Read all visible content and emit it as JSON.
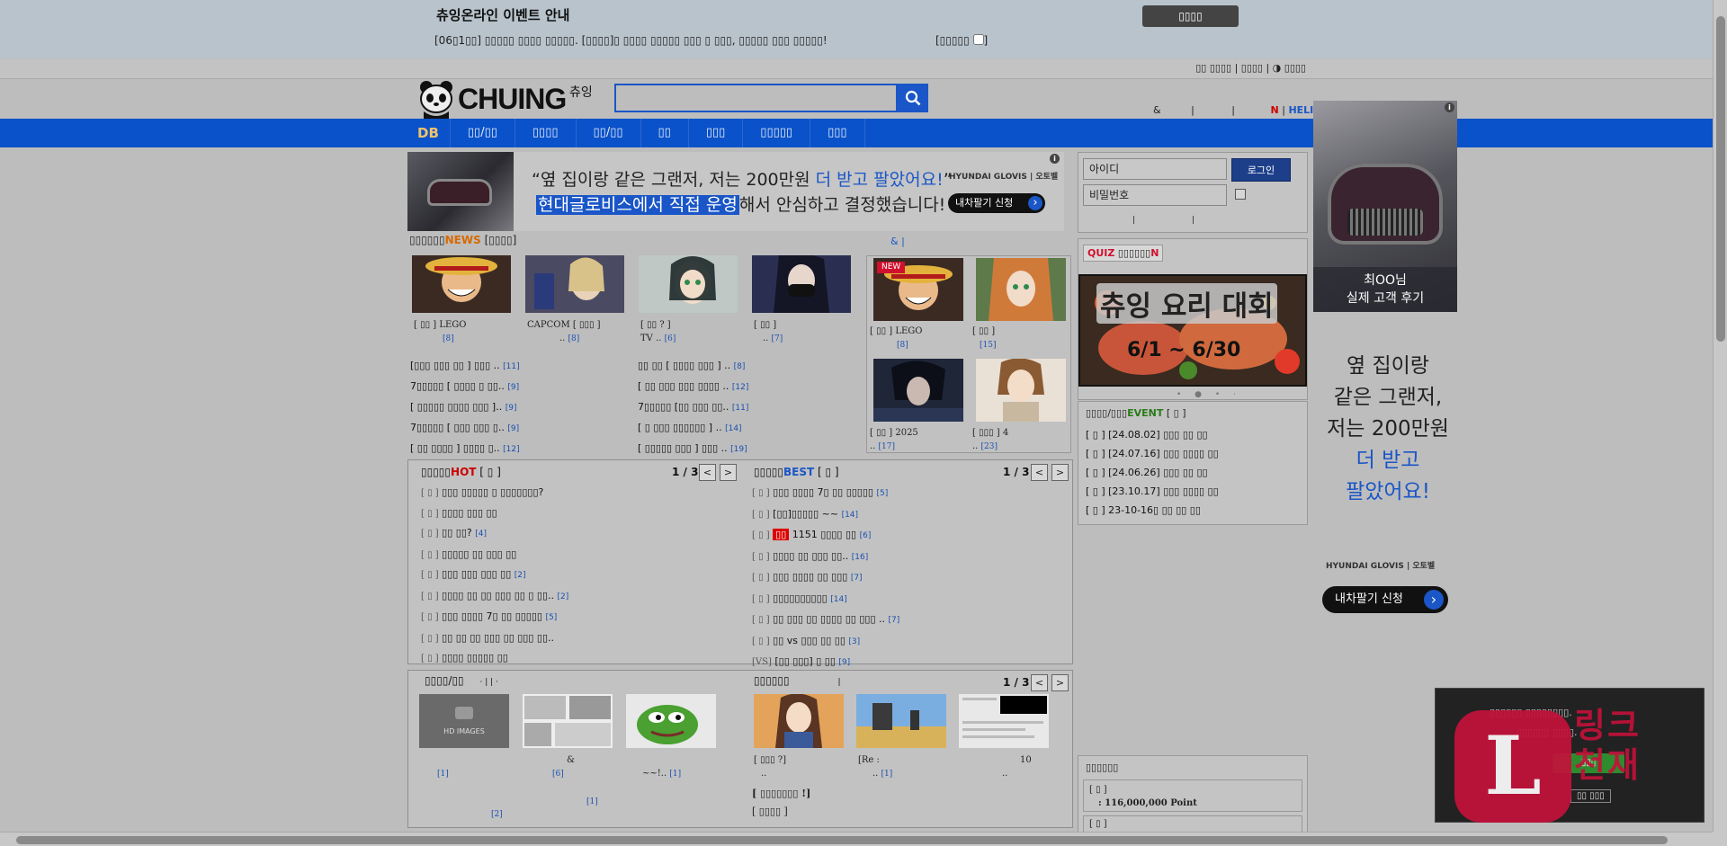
{
  "notice": {
    "title": "츄잉온라인 이벤트 안내",
    "close_label": "▯▯▯▯",
    "line": "[06▯1▯▯] ▯▯▯▯▯ ▯▯▯▯ ▯▯▯▯▯. [▯▯▯▯]▯ ▯▯▯▯ ▯▯▯▯▯ ▯▯▯ ▯ ▯▯▯, ▯▯▯▯▯ ▯▯▯ ▯▯▯▯▯!",
    "dont_show_label": "[▯▯▯▯▯",
    "dont_show_end": "]"
  },
  "toplinks": "▯▯ ▯▯▯▯ | ▯▯▯▯ | ◑ ▯▯▯▯",
  "header": {
    "logo_text": "CHUING",
    "logo_sub": "츄잉",
    "search_value": "",
    "right_amp": "&",
    "right_sep1": "|",
    "right_sep2": "|",
    "right_n": "N",
    "right_sep3": " | ",
    "right_helix": "HELIX"
  },
  "nav": {
    "items": [
      "DB",
      "▯▯/▯▯",
      "▯▯▯▯",
      "▯▯/▯▯",
      "▯▯",
      "▯▯▯",
      "▯▯▯▯▯",
      "▯▯▯"
    ]
  },
  "banner": {
    "line1_a": "“옆 집이랑 같은 그랜저, 저는 200만원 ",
    "line1_b": "더 받고 팔았어요!",
    "line1_c": "”",
    "line2_a": "현대글로비스에서 직접 운영",
    "line2_b": "해서 안심하고 결정했습니다!",
    "brand": "HYUNDAI GLOVIS | 오토벨",
    "cta": "내차팔기 신청",
    "info": "i"
  },
  "news": {
    "head_a": "▯▯▯▯▯▯",
    "head_tag": "NEWS",
    "head_b": " [▯▯▯▯]",
    "side_head": "&  |",
    "thumbs": [
      {
        "cap1": "[ ▯▯ ]  LEGO",
        "cnt": "[8]"
      },
      {
        "cap1": "CAPCOM [ ▯▯▯ ]",
        "cap2": "..",
        "cnt": "[8]"
      },
      {
        "cap1": "[ ▯▯ ? ]",
        "cap2": "TV ..",
        "cnt": "[6]"
      },
      {
        "cap1": "[ ▯▯ ]",
        "cap2": "..",
        "cnt": "[7]"
      }
    ],
    "list_left": [
      {
        "t": "[▯▯▯ ▯▯▯ ▯▯ ] ▯▯▯ ..",
        "c": "[11]"
      },
      {
        "t": "7▯▯▯▯▯ [ ▯▯▯▯ ▯ ▯▯..",
        "c": "[9]"
      },
      {
        "t": "[ ▯▯▯▯▯ ▯▯▯▯ ▯▯▯ ]..",
        "c": "[9]"
      },
      {
        "t": "7▯▯▯▯▯ [ ▯▯▯ ▯▯▯ ▯..",
        "c": "[9]"
      },
      {
        "t": "[ ▯▯ ▯▯▯▯ ] ▯▯▯▯ ▯..",
        "c": "[12]"
      }
    ],
    "list_right": [
      {
        "t": "▯▯ ▯▯ [ ▯▯▯▯ ▯▯▯ ] ..",
        "c": "[8]"
      },
      {
        "t": "[ ▯▯ ▯▯▯ ▯▯▯ ▯▯▯▯ ..",
        "c": "[12]"
      },
      {
        "t": "7▯▯▯▯▯ [▯▯ ▯▯▯ ▯▯..",
        "c": "[11]"
      },
      {
        "t": "[ ▯ ▯▯▯ ▯▯▯▯▯▯ ] ..",
        "c": "[14]"
      },
      {
        "t": "[ ▯▯▯▯▯ ▯▯▯ ] ▯▯▯ ..",
        "c": "[19]"
      }
    ],
    "mini": [
      {
        "badge": "NEW",
        "cap1": "[ ▯▯ ]  LEGO",
        "cnt": "[8]"
      },
      {
        "cap1": "[ ▯▯ ]",
        "cnt": "[15]"
      },
      {
        "cap1": "[ ▯▯ ] 2025",
        "cap2": "..",
        "cnt": "[17]"
      },
      {
        "cap1": "[ ▯▯▯ ] 4",
        "cap2": "..",
        "cnt": "[23]"
      }
    ]
  },
  "hot": {
    "head_a": "▯▯▯▯▯",
    "head_tag": "HOT",
    "head_b": " [ ▯ ]",
    "pager": "1 / 3",
    "prev": "<",
    "next": ">",
    "items": [
      {
        "t": "▯▯▯ ▯▯▯▯▯ ▯ ▯▯▯▯▯▯▯?",
        "c": ""
      },
      {
        "t": "▯▯▯▯ ▯▯▯ ▯▯",
        "c": ""
      },
      {
        "t": "▯▯ ▯▯?",
        "c": "[4]"
      },
      {
        "t": "▯▯▯▯▯ ▯▯ ▯▯▯ ▯▯",
        "c": ""
      },
      {
        "t": "▯▯▯ ▯▯▯ ▯▯▯ ▯▯",
        "c": "[2]"
      },
      {
        "t": "▯▯▯▯ ▯▯ ▯▯ ▯▯▯ ▯▯ ▯ ▯▯..",
        "c": "[2]"
      },
      {
        "t": "▯▯▯ ▯▯▯▯ 7▯ ▯▯ ▯▯▯▯▯",
        "c": "[5]"
      },
      {
        "t": "▯▯ ▯▯ ▯▯ ▯▯▯ ▯▯ ▯▯▯ ▯▯..",
        "c": ""
      },
      {
        "t": "▯▯▯▯ ▯▯▯▯▯ ▯▯",
        "c": ""
      }
    ]
  },
  "best": {
    "head_a": "▯▯▯▯▯",
    "head_tag": "BEST",
    "head_b": " [ ▯ ]",
    "pager": "1 / 3",
    "prev": "<",
    "next": ">",
    "items": [
      {
        "t": "▯▯▯ ▯▯▯▯ 7▯ ▯▯ ▯▯▯▯▯",
        "c": "[5]"
      },
      {
        "t": "[▯▯]▯▯▯▯▯ ~~",
        "c": "[14]"
      },
      {
        "tag": "▯▯",
        "t": "1151 ▯▯▯▯ ▯▯",
        "c": "[6]"
      },
      {
        "t": "▯▯▯▯ ▯▯ ▯▯▯ ▯▯..",
        "c": "[16]"
      },
      {
        "t": "▯▯▯ ▯▯▯▯ ▯▯ ▯▯▯",
        "c": "[7]"
      },
      {
        "t": "▯▯▯▯▯▯▯▯▯▯",
        "c": "[14]"
      },
      {
        "t": "▯▯ ▯▯▯ ▯▯ ▯▯▯▯ ▯▯ ▯▯▯ ..",
        "c": "[7]"
      },
      {
        "t": "▯▯ vs ▯▯▯ ▯▯ ▯▯",
        "c": "[3]"
      },
      {
        "pre": "[VS]",
        "t": "[▯▯ ▯▯▯] ▯ ▯▯",
        "c": "[9]"
      }
    ]
  },
  "gallery": {
    "head": "▯▯▯▯/▯▯",
    "head_seps": "·   |   |   ·",
    "items": [
      {
        "label": "HD IMAGES",
        "cnt": "[1]"
      },
      {
        "cap": "&",
        "cnt": "[6]",
        "cnt2": "[1]"
      },
      {
        "cap": "~~!..",
        "cnt": "[1]"
      }
    ],
    "extra_cnt": "[2]"
  },
  "gallery2": {
    "head": "▯▯▯▯▯▯",
    "sep": "|",
    "pager": "1 / 3",
    "prev": "<",
    "next": ">",
    "items": [
      {
        "cap1": "[ ▯▯▯ ?]",
        "cap2": ".."
      },
      {
        "cap1": "[Re :",
        "cap2": "..",
        "cnt": "[1]"
      },
      {
        "cap1": "10",
        "cap2": ".."
      }
    ],
    "line1": "[ ▯▯▯▯▯▯▯ !]",
    "line2": "[ ▯▯▯▯ ]"
  },
  "login": {
    "id_placeholder": "아이디",
    "pw_placeholder": "비밀번호",
    "login_btn": "로그인",
    "links": "|  |"
  },
  "quiz": {
    "tag_q": "QUIZ",
    "tag_text": " ▯▯▯▯▯▯",
    "tag_n": "N",
    "img_t1": "츄잉 요리 대회",
    "img_t2": "6/1 ~ 6/30",
    "dots": "• ● • ·"
  },
  "event": {
    "head_a": "▯▯▯▯/▯▯▯",
    "head_tag": "EVENT",
    "head_b": " [ ▯ ]",
    "items": [
      "[ ▯ ] [24.08.02] ▯▯▯ ▯▯ ▯▯",
      "[ ▯ ] [24.07.16] ▯▯▯ ▯▯▯▯ ▯▯",
      "[ ▯ ] [24.06.26] ▯▯▯ ▯▯ ▯▯",
      "[ ▯ ] [23.10.17] ▯▯▯ ▯▯▯▯ ▯▯",
      "[ ▯ ] 23-10-16▯ ▯▯ ▯▯ ▯▯"
    ]
  },
  "rank": {
    "head": "▯▯▯▯▯▯",
    "row1_a": "[ ▯ ]",
    "row1_b": ": 116,000,000 Point",
    "row2_a": "[ ▯ ]"
  },
  "side_ad": {
    "caption1": "최OO님",
    "caption2": "실제 고객 후기",
    "t1": "옆 집이랑",
    "t2": "같은 그랜저,",
    "t3": "저는 200만원",
    "t4": "더 받고",
    "t5": "팔았어요!",
    "brand": "HYUNDAI GLOVIS | 오토벨",
    "cta": "내차팔기 신청"
  },
  "popup": {
    "line1": "▯▯▯▯▯▯ ▯▯▯▯▯▯▯▯.",
    "line2": "▯▯▯▯▯▯ ▯▯▯▯.",
    "btn": "▯▯▯",
    "btn2": "▯▯ ▯▯▯",
    "logo_letter": "L",
    "brand1": "링크",
    "brand2": "천재"
  }
}
